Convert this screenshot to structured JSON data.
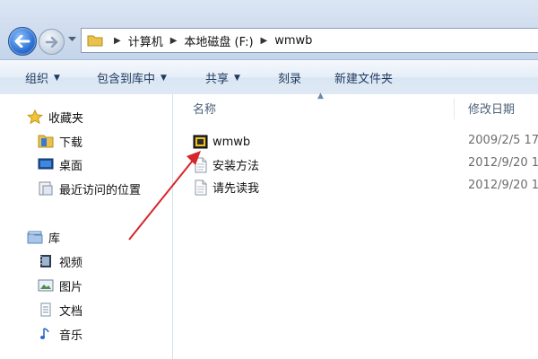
{
  "address": {
    "path": [
      "计算机",
      "本地磁盘 (F:)",
      "wmwb"
    ]
  },
  "toolbar": {
    "organize": "组织",
    "include_in_library": "包含到库中",
    "share": "共享",
    "burn": "刻录",
    "new_folder": "新建文件夹"
  },
  "nav": {
    "favorites_label": "收藏夹",
    "favorites": [
      "下载",
      "桌面",
      "最近访问的位置"
    ],
    "libraries_label": "库",
    "libraries": [
      "视频",
      "图片",
      "文档",
      "音乐"
    ]
  },
  "columns": {
    "name": "名称",
    "date_modified": "修改日期"
  },
  "files": [
    {
      "name": "wmwb",
      "date": "2009/2/5 17",
      "icon": "app-icon"
    },
    {
      "name": "安装方法",
      "date": "2012/9/20 1",
      "icon": "text-file-icon"
    },
    {
      "name": "请先读我",
      "date": "2012/9/20 1",
      "icon": "text-file-icon"
    }
  ],
  "colors": {
    "annotation_arrow": "#d6262a",
    "window_frame": "#cfdcee"
  }
}
